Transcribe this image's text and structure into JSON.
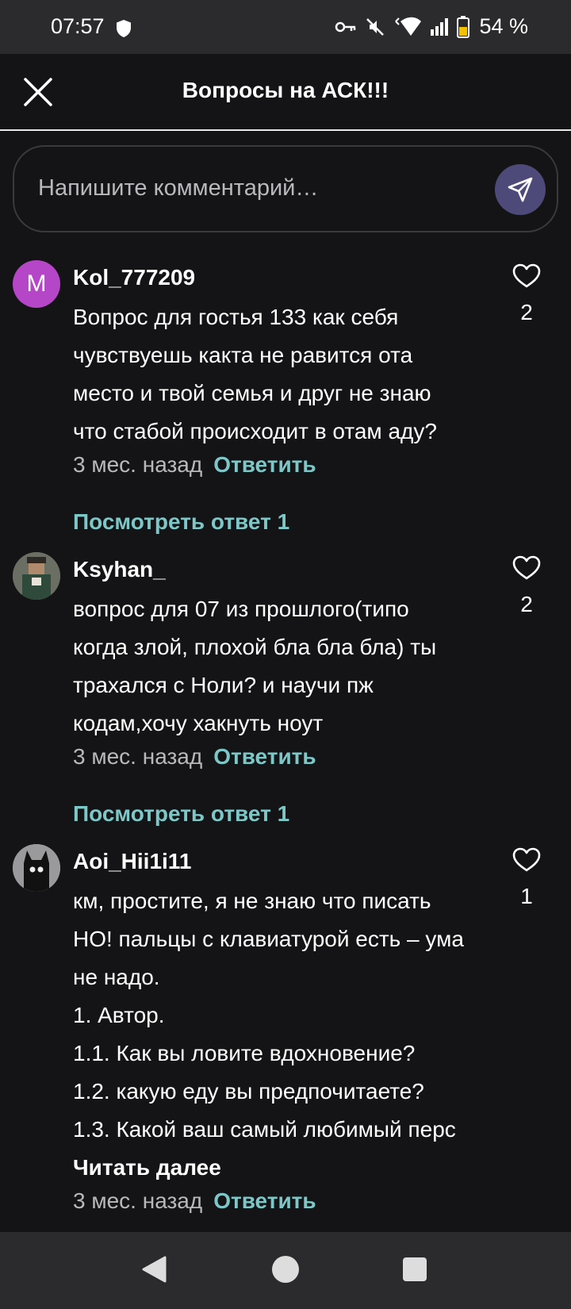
{
  "status_bar": {
    "time": "07:57",
    "battery": "54 %",
    "icons": [
      "shield-icon",
      "key-icon",
      "mute-icon",
      "wifi-icon",
      "signal-icon",
      "battery-icon"
    ]
  },
  "header": {
    "title": "Вопросы на АСК!!!",
    "close_icon": "close-icon"
  },
  "comment_input": {
    "placeholder": "Напишите комментарий…",
    "send_icon": "send-icon",
    "send_color": "#4d4a7a"
  },
  "comments": [
    {
      "avatar_letter": "M",
      "avatar_color": "#b546c7",
      "username": "Kol_777209",
      "lines": [
        "Вопрос для гостья 133 как себя",
        "чувствуешь какта не равится ота",
        "место и твой семья и друг не знаю",
        "что стабой происходит в отам аду?"
      ],
      "time": "3 мес. назад",
      "reply_label": "Ответить",
      "likes": "2",
      "view_replies": "Посмотреть ответ 1"
    },
    {
      "avatar_letter": "",
      "username": "Ksyhan_",
      "lines": [
        "вопрос для 07 из прошлого(типо",
        "когда злой, плохой бла бла бла) ты",
        "трахался с Ноли? и научи пж",
        "кодам,хочу хакнуть ноут"
      ],
      "time": "3 мес. назад",
      "reply_label": "Ответить",
      "likes": "2",
      "view_replies": "Посмотреть ответ 1"
    },
    {
      "avatar_letter": "",
      "username": "Aoi_Hii1i11",
      "lines": [
        "км, простите, я не знаю что писать",
        "НО! пальцы с клавиатурой есть – ума",
        "не надо.",
        "1. Автор.",
        "1.1. Как вы ловите вдохновение?",
        "1.2. какую еду вы предпочитаете?",
        "1.3. Какой ваш самый любимый перс"
      ],
      "read_more": "Читать далее",
      "time": "3 мес. назад",
      "reply_label": "Ответить",
      "likes": "1"
    }
  ],
  "accent_color": "#7ec7c8",
  "nav_bar": {
    "icons": [
      "back-icon",
      "home-icon",
      "recents-icon"
    ]
  }
}
